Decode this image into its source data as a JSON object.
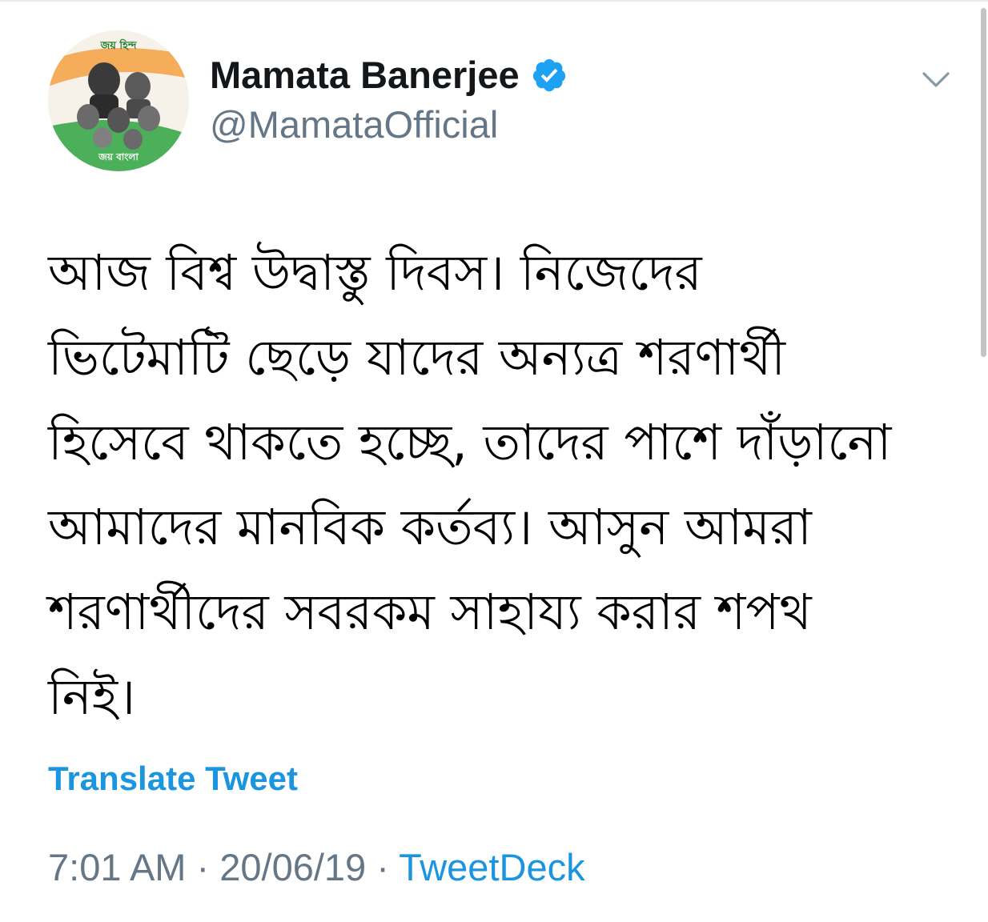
{
  "tweet": {
    "avatar": {
      "top_text": "জয় হিন্দ",
      "bottom_text": "জয় বাংলা"
    },
    "author": {
      "display_name": "Mamata Banerjee",
      "handle": "@MamataOfficial",
      "verified": true
    },
    "text": "আজ বিশ্ব উদ্বাস্তু দিবস। নিজেদের\nভিটেমাটি ছেড়ে যাদের অন্যত্র শরণার্থী\nহিসেবে থাকতে হচ্ছে, তাদের পাশে দাঁড়ানো\nআমাদের মানবিক কর্তব্য। আসুন আমরা\nশরণার্থীদের সবরকম সাহায্য করার শপথ\nনিই।",
    "translate_label": "Translate Tweet",
    "time": "7:01 AM",
    "separator": " · ",
    "date": "20/06/19",
    "source": "TweetDeck"
  },
  "icons": {
    "verified": "verified-badge-icon",
    "menu": "chevron-down-icon"
  },
  "colors": {
    "link": "#1b95e0",
    "secondary_text": "#657786",
    "verified": "#1da1f2"
  }
}
